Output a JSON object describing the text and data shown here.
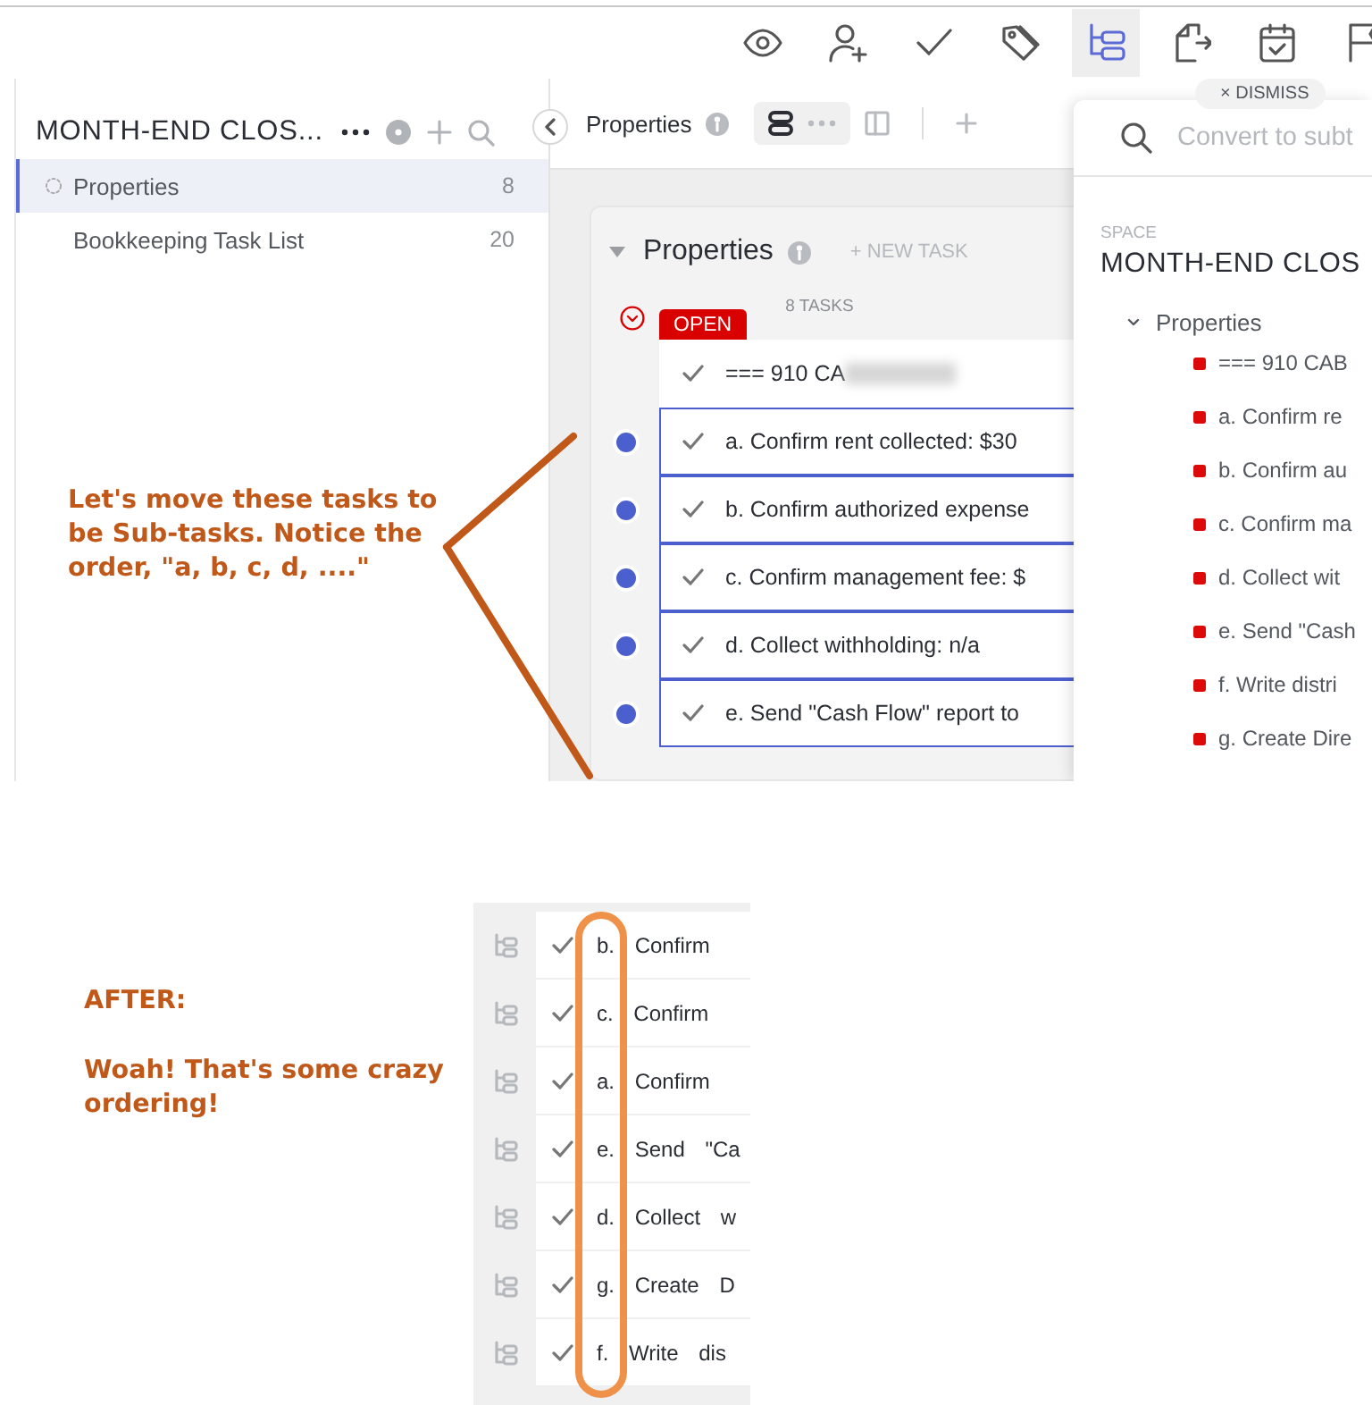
{
  "toolbar": [
    {
      "kind": "watch",
      "selected": false
    },
    {
      "kind": "assign",
      "selected": false
    },
    {
      "kind": "complete",
      "selected": false
    },
    {
      "kind": "tags",
      "selected": false
    },
    {
      "kind": "subtasks",
      "selected": true
    },
    {
      "kind": "move",
      "selected": false
    },
    {
      "kind": "date",
      "selected": false
    },
    {
      "kind": "flag",
      "selected": false
    }
  ],
  "sidebar": {
    "title": "MONTH-END CLOS...",
    "items": [
      {
        "label": "Properties",
        "count": "8",
        "selected": true
      },
      {
        "label": "Bookkeeping Task List",
        "count": "20",
        "selected": false
      }
    ]
  },
  "list_view": {
    "tab": "Properties",
    "group_title": "Properties",
    "new_task": "+ NEW TASK",
    "status": "OPEN",
    "task_count": "8 TASKS",
    "tasks": [
      {
        "title": "=== 910 CA",
        "redacted": true,
        "selected": false
      },
      {
        "title": "a. Confirm rent collected: $30",
        "redacted": false,
        "selected": true
      },
      {
        "title": "b. Confirm authorized expense",
        "redacted": false,
        "selected": true
      },
      {
        "title": "c. Confirm management fee: $",
        "redacted": false,
        "selected": true
      },
      {
        "title": "d. Collect withholding: n/a",
        "redacted": false,
        "selected": true
      },
      {
        "title": "e. Send \"Cash Flow\" report to",
        "redacted": false,
        "selected": true
      }
    ]
  },
  "convert_panel": {
    "dismiss": "× DISMISS",
    "placeholder": "Convert to subt",
    "section_label": "SPACE",
    "space_title": "MONTH-END CLOS",
    "tree": [
      {
        "label": "Properties",
        "expanded": true,
        "children": [
          {
            "label": "=== 910 CAB",
            "color": "#dd0a0a"
          },
          {
            "label": "a. Confirm re",
            "color": "#dd0a0a"
          },
          {
            "label": "b. Confirm au",
            "color": "#dd0a0a"
          },
          {
            "label": "c. Confirm ma",
            "color": "#dd0a0a"
          },
          {
            "label": "d. Collect wit",
            "color": "#dd0a0a"
          },
          {
            "label": "e. Send \"Cash",
            "color": "#dd0a0a"
          },
          {
            "label": "f. Write distri",
            "color": "#dd0a0a"
          },
          {
            "label": "g. Create Dire",
            "color": "#dd0a0a"
          }
        ]
      }
    ]
  },
  "annotations": {
    "before_note": "Let's move these tasks to be Sub-tasks. Notice the order, \"a, b, c, d, ....\"",
    "after_heading": "AFTER:",
    "after_note": "Woah! That's some crazy ordering!"
  },
  "after_strip": {
    "rows": [
      {
        "title": "b. Confirm"
      },
      {
        "title": "c. Confirm"
      },
      {
        "title": "a. Confirm"
      },
      {
        "title": "e. Send \"Ca"
      },
      {
        "title": "d. Collect w"
      },
      {
        "title": "g. Create D"
      },
      {
        "title": "f. Write dis"
      }
    ]
  }
}
